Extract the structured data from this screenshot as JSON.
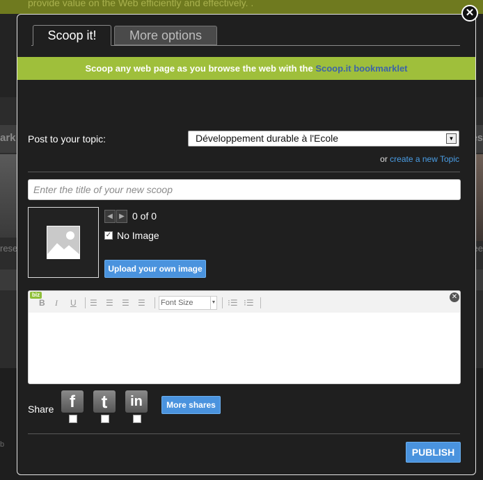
{
  "background": {
    "top_text": "provide value on the Web efficiently and effectively. .",
    "band_left": "ark",
    "band_right": "es",
    "small_left": "rese",
    "small_right": "ree",
    "bottom_letter": "b"
  },
  "modal": {
    "close_glyph": "✕",
    "tabs": [
      {
        "label": "Scoop it!"
      },
      {
        "label": "More options"
      }
    ],
    "banner": {
      "text": "Scoop any web page as you browse the web with the ",
      "link": "Scoop.it bookmarklet"
    },
    "topic": {
      "label": "Post to your topic:",
      "selected": "Développement durable à l'Ecole",
      "or_text": "or ",
      "create_link": "create a new Topic"
    },
    "title_input": {
      "placeholder": "Enter the title of your new scoop",
      "value": ""
    },
    "image": {
      "count": "0 of 0",
      "no_image_label": "No Image",
      "no_image_checked": true,
      "upload_label": "Upload your own image"
    },
    "editor": {
      "badge": "biz",
      "font_size_label": "Font Size"
    },
    "share": {
      "label": "Share",
      "networks": [
        "f",
        "t",
        "in"
      ],
      "more_label": "More shares"
    },
    "publish_label": "PUBLISH"
  }
}
